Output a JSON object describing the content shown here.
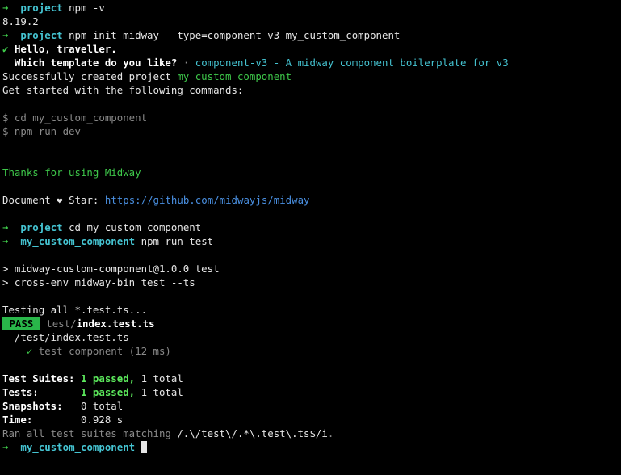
{
  "colors": {
    "background": "#000000",
    "foreground": "#e6e6e6",
    "prompt_arrow": "#3ec84a",
    "directory": "#45c4d2",
    "success": "#5ce85c",
    "muted": "#8a8a8a",
    "link": "#4a90e2",
    "pass_badge": "#29b74a"
  },
  "icons": {
    "prompt": "right-arrow",
    "check": "check-mark",
    "heart": "heart",
    "cursor": "block-cursor"
  },
  "terminal": {
    "prompt_symbol": "➜",
    "cmd1": {
      "dir": "project",
      "command": "npm -v"
    },
    "npm_version": "8.19.2",
    "cmd2": {
      "dir": "project",
      "command": "npm init midway --type=component-v3 my_custom_component"
    },
    "hello": {
      "check": "✔",
      "text": "Hello, traveller."
    },
    "template_question": {
      "question": "Which template do you like?",
      "sep": "·",
      "answer": "component-v3 - A midway component boilerplate for v3"
    },
    "created": {
      "prefix": "Successfully created project",
      "name": "my_custom_component"
    },
    "get_started": "Get started with the following commands:",
    "step_cd": "$ cd my_custom_component",
    "step_dev": "$ npm run dev",
    "thanks": "Thanks for using Midway",
    "document": {
      "prefix": "Document",
      "heart": "❤",
      "star": "Star:",
      "url": "https://github.com/midwayjs/midway"
    },
    "cmd3": {
      "dir": "project",
      "command": "cd my_custom_component"
    },
    "cmd4": {
      "dir": "my_custom_component",
      "command": "npm run test"
    },
    "script_name": "> midway-custom-component@1.0.0 test",
    "script_cmd": "> cross-env midway-bin test --ts",
    "testing": "Testing all *.test.ts...",
    "pass_line": {
      "badge": "PASS",
      "dir": "test/",
      "file": "index.test.ts"
    },
    "suite_path": "/test/index.test.ts",
    "test_case": {
      "check": "✓",
      "name": "test component (12 ms)"
    },
    "summary": {
      "suites": {
        "label": "Test Suites:",
        "passed": "1 passed,",
        "total": "1 total"
      },
      "tests": {
        "label": "Tests:",
        "passed": "1 passed,",
        "total": "1 total"
      },
      "snapshots": {
        "label": "Snapshots:",
        "value": "0 total"
      },
      "time": {
        "label": "Time:",
        "value": "0.928 s"
      }
    },
    "ran_all": {
      "prefix": "Ran all test suites matching",
      "pattern": "/.\\/test\\/.*\\.test\\.ts$/i",
      "suffix": "."
    },
    "final_prompt": {
      "dir": "my_custom_component"
    }
  }
}
